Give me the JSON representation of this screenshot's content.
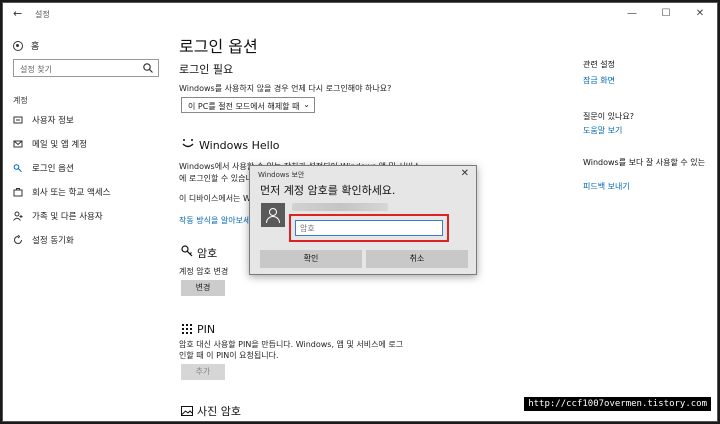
{
  "titlebar": {
    "app_title": "설정",
    "minimize": "—",
    "maximize": "☐",
    "close": "✕",
    "back": "←"
  },
  "sidebar": {
    "home_label": "홈",
    "search_placeholder": "설정 찾기",
    "section": "계정",
    "items": [
      {
        "label": "사용자 정보"
      },
      {
        "label": "메일 및 앱 계정"
      },
      {
        "label": "로그인 옵션"
      },
      {
        "label": "회사 또는 학교 액세스"
      },
      {
        "label": "가족 및 다른 사용자"
      },
      {
        "label": "설정 동기화"
      }
    ]
  },
  "main": {
    "title": "로그인 옵션",
    "require": {
      "heading": "로그인 필요",
      "description": "Windows를 사용하지 않을 경우 언제 다시 로그인해야 하나요?",
      "dropdown_value": "이 PC를 절전 모드에서 해제할 때"
    },
    "hello": {
      "heading": "Windows Hello",
      "line1": "Windows에서 사용할 수 있는 장치가 설정되어 Windows 앱 및 서비스",
      "line2": "에 로그인할 수 있습니다.",
      "line3": "이 디바이스에서는 Windows Hello를 사용할 수 없습니다.",
      "link": "작동 방식을 알아보세요."
    },
    "password": {
      "heading": "암호",
      "description": "계정 암호 변경",
      "button": "변경"
    },
    "pin": {
      "heading": "PIN",
      "line1": "암호 대신 사용할 PIN을 만듭니다. Windows, 앱 및 서비스에 로그",
      "line2": "인할 때 이 PIN이 요청됩니다.",
      "button": "추가"
    },
    "picture": {
      "heading": "사진 암호"
    }
  },
  "right": {
    "related_title": "관련 설정",
    "related_link": "잠금 화면",
    "question_title": "질문이 있나요?",
    "question_link": "도움말 보기",
    "improve_title": "Windows를 보다 잘 사용할 수 있는",
    "improve_link": "피드백 보내기"
  },
  "dialog": {
    "title": "Windows 보안",
    "close": "✕",
    "heading": "먼저 계정 암호를 확인하세요.",
    "password_placeholder": "암호",
    "ok": "확인",
    "cancel": "취소"
  },
  "watermark": "http://ccf1007overmen.tistory.com",
  "colors": {
    "link": "#0067b8",
    "highlight": "#dd2222"
  }
}
